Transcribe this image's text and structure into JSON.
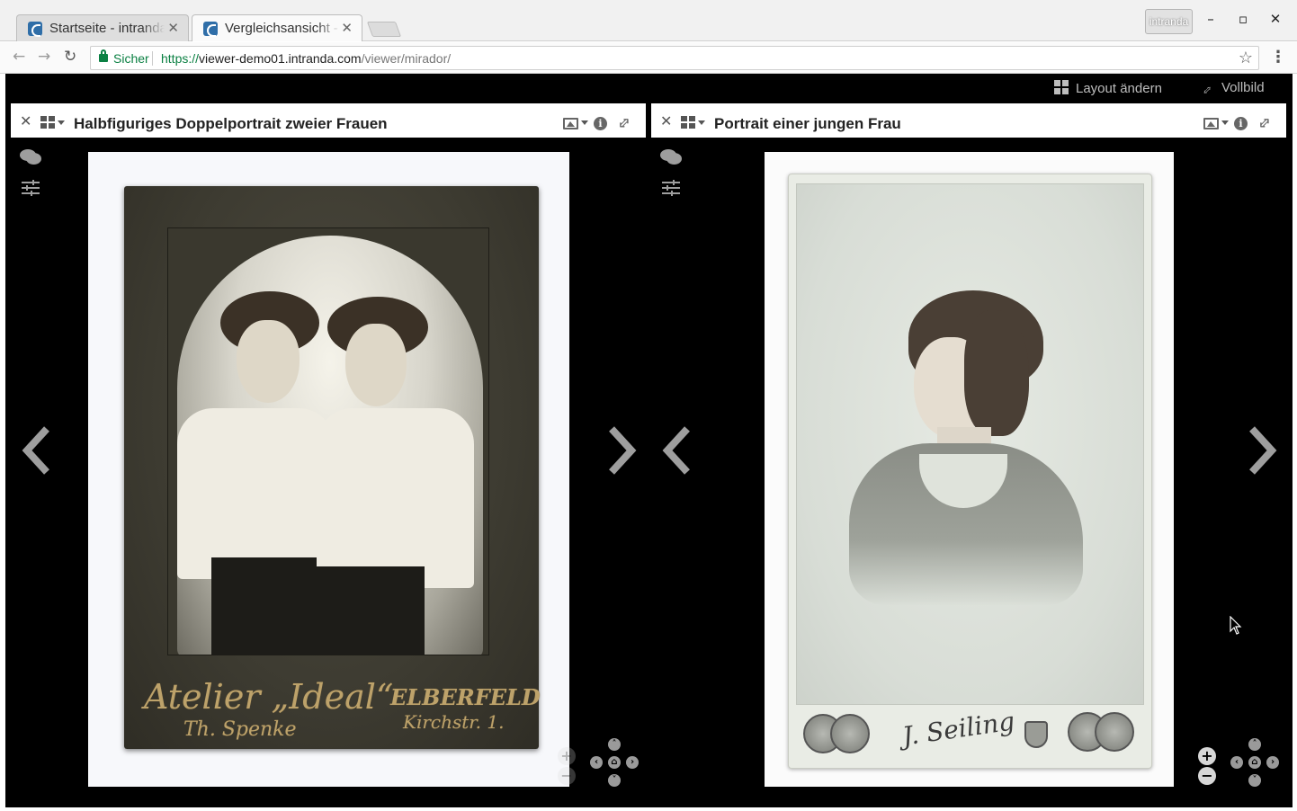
{
  "browser": {
    "tabs": [
      {
        "title": "Startseite - intranda",
        "active": false
      },
      {
        "title": "Vergleichsansicht - intranda",
        "active": true
      }
    ],
    "profile_label": "intranda",
    "security_label": "Sicher",
    "url_scheme": "https://",
    "url_host": "viewer-demo01.intranda.com",
    "url_path": "/viewer/mirador/"
  },
  "mirador": {
    "topbar": {
      "layout_label": "Layout ändern",
      "fullscreen_label": "Vollbild"
    },
    "windows": [
      {
        "title": "Halbfiguriges Doppelportrait zweier Frauen",
        "photo_text": {
          "studio": "Atelier „Ideal“",
          "city": "ELBERFELD",
          "photographer": "Th. Spenke",
          "address": "Kirchstr. 1."
        }
      },
      {
        "title": "Portrait einer jungen Frau",
        "photo_text": {
          "signature": "J. Seiling"
        }
      }
    ]
  },
  "colors": {
    "app_background": "#000000",
    "secure_green": "#0b8043",
    "gold_lettering": "#bda26a"
  }
}
